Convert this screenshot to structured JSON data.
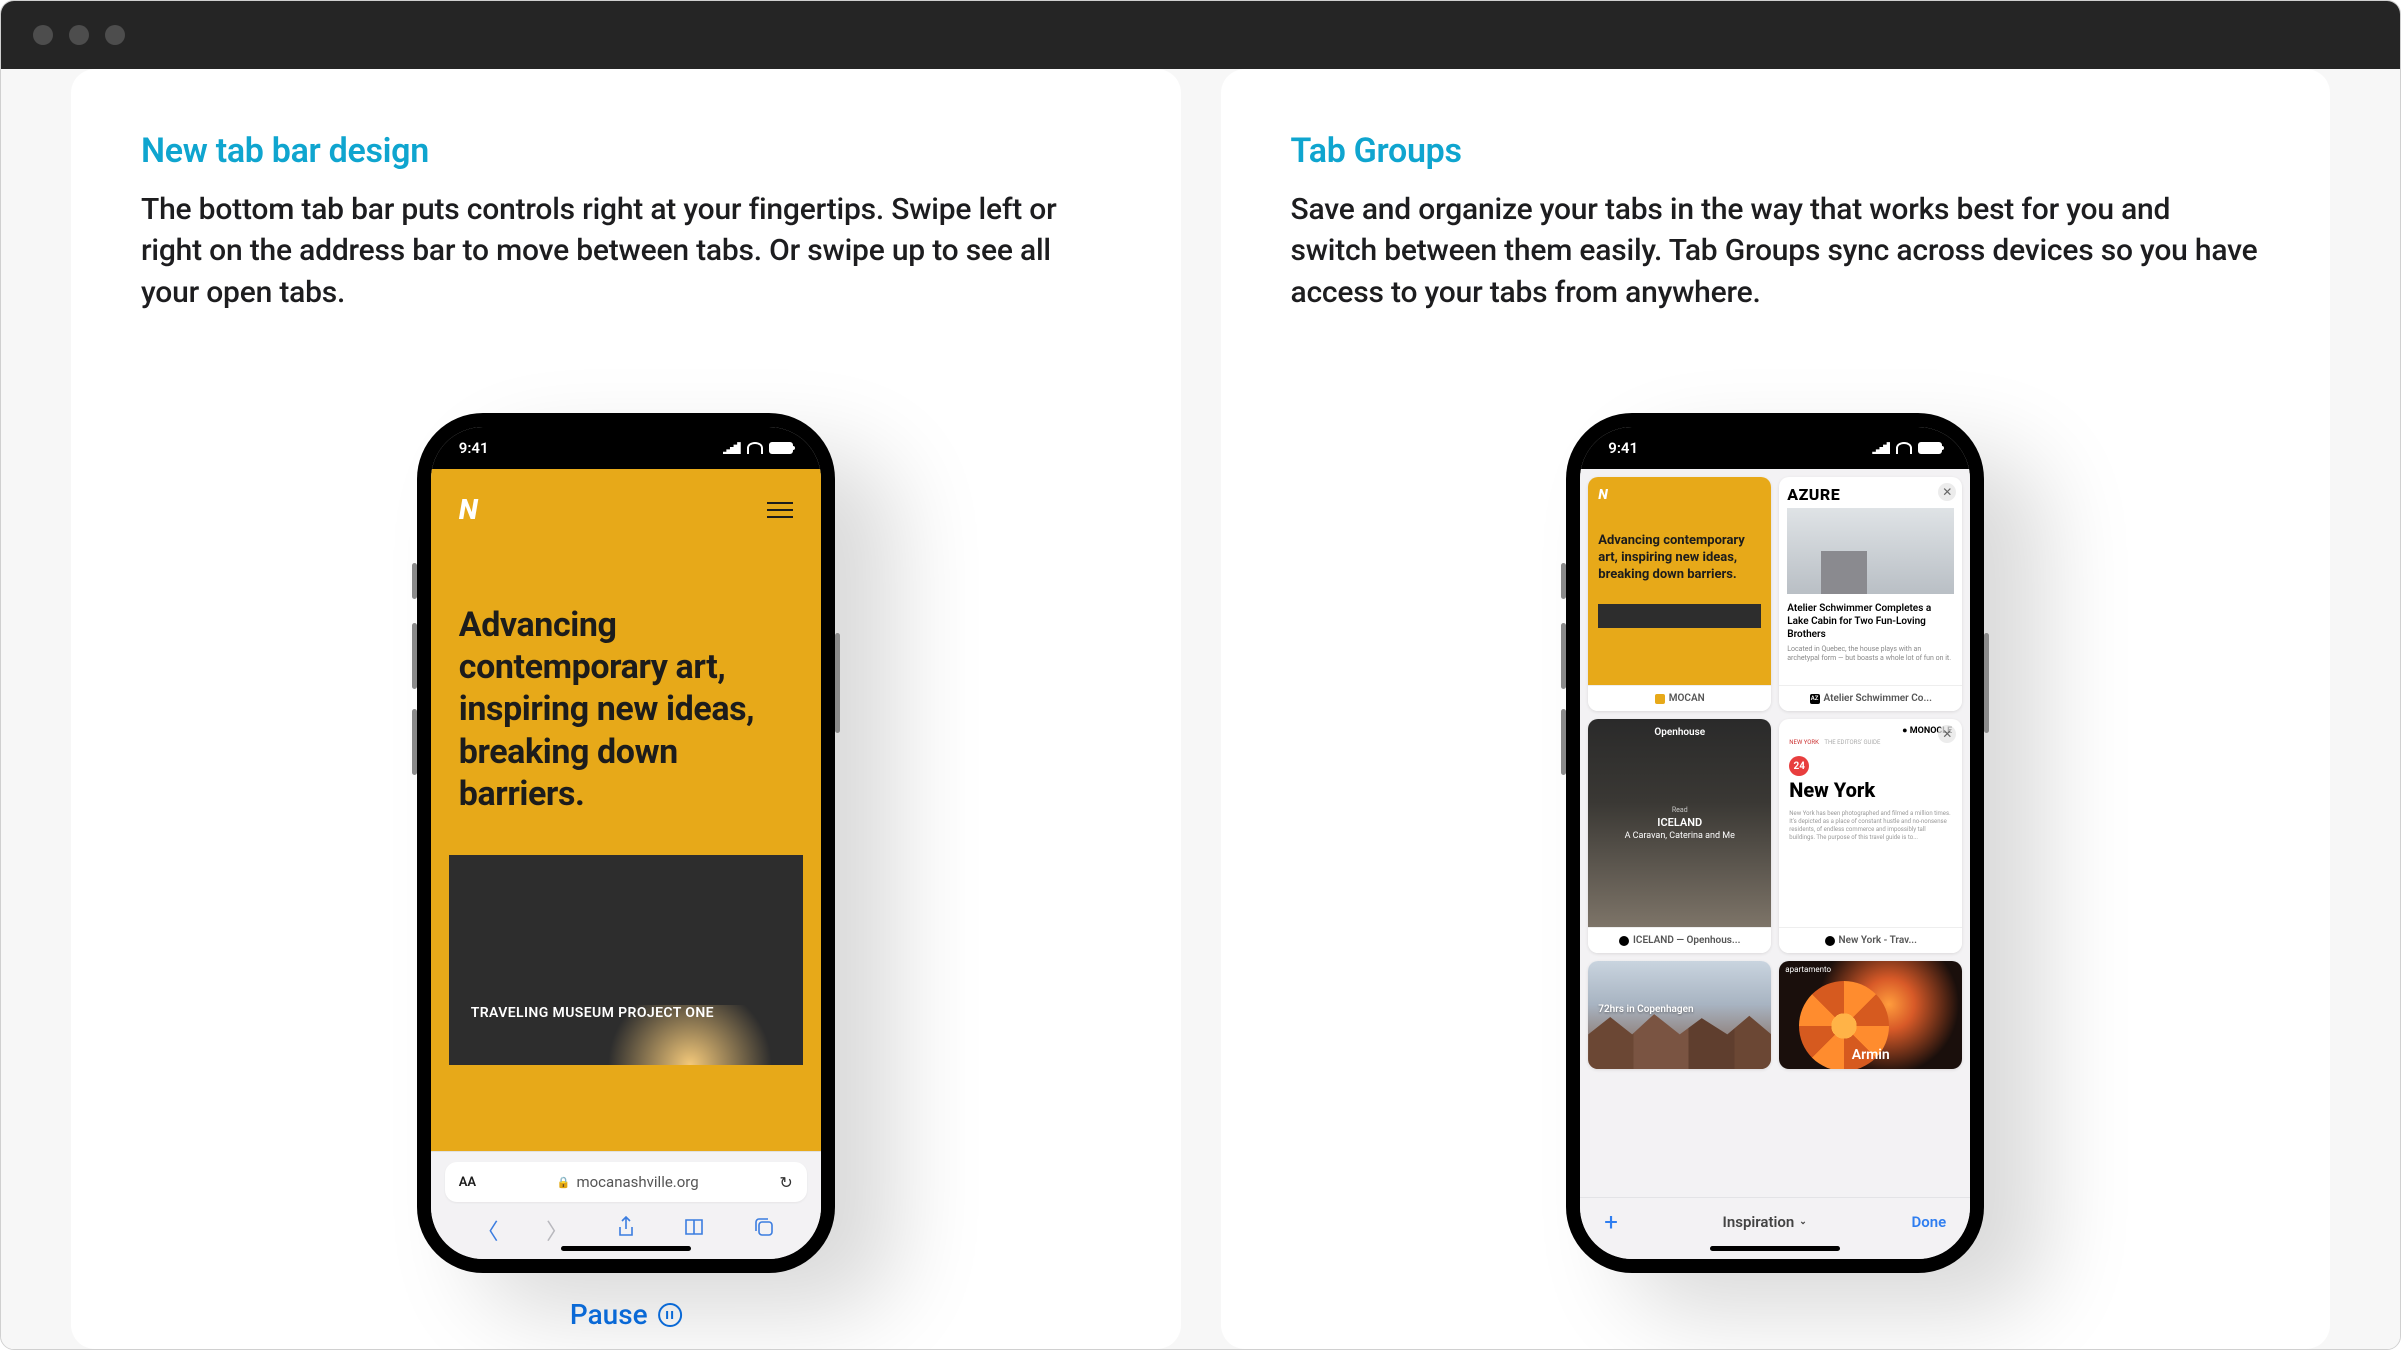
{
  "left_card": {
    "heading": "New tab bar design",
    "body": "The bottom tab bar puts controls right at your fingertips. Swipe left or right on the address bar to move between tabs. Or swipe up to see all your open tabs."
  },
  "right_card": {
    "heading": "Tab Groups",
    "body": "Save and organize your tabs in the way that works best for you and switch between them easily. Tab Groups sync across devices so you have access to your tabs from anywhere."
  },
  "status": {
    "time": "9:41"
  },
  "left_phone": {
    "hero_text": "Advancing contemporary art, inspiring new ideas, breaking down barriers.",
    "project_label": "TRAVELING MUSEUM PROJECT ONE",
    "aa_label": "AA",
    "address": "mocanashville.org"
  },
  "pause_label": "Pause",
  "right_phone": {
    "tiles": [
      {
        "footer": "MOCAN",
        "hero": "Advancing contemporary art, inspiring new ideas, breaking down barriers."
      },
      {
        "brand": "AZURE",
        "headline": "Atelier Schwimmer Completes a Lake Cabin for Two Fun-Loving Brothers",
        "sub": "Located in Quebec, the house plays with an archetypal form — but boasts a whole lot of fun on it.",
        "footer_prefix": "AZ",
        "footer": "Atelier Schwimmer Co..."
      },
      {
        "top": "Openhouse",
        "mid": "Read",
        "title": "ICELAND",
        "sub": "A Caravan, Caterina and Me",
        "footer": "ICELAND — Openhous..."
      },
      {
        "brand": "● MONOCLE",
        "tag": "NEW YORK",
        "tag2": "THE EDITORS' GUIDE",
        "badge": "24",
        "city": "New York",
        "desc": "New York has been photographed and filmed a million times. It's depicted as a place of constant hustle and no-nonsense residents, of endless commerce and impossibly tall buildings. The purpose of this travel guide is to...",
        "footer": "New York - Trav..."
      },
      {
        "overlay": "72hrs in Copenhagen"
      },
      {
        "brand": "apartamento",
        "name": "Armin"
      }
    ],
    "toolbar": {
      "group_name": "Inspiration",
      "done": "Done"
    }
  }
}
